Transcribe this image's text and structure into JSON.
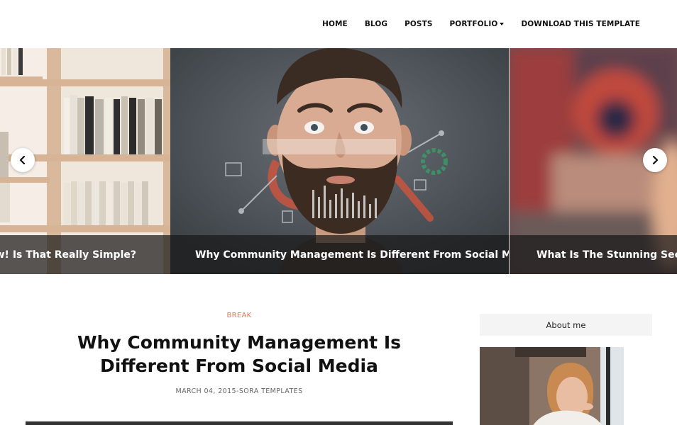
{
  "nav": {
    "items": [
      {
        "label": "HOME"
      },
      {
        "label": "BLOG"
      },
      {
        "label": "POSTS"
      },
      {
        "label": "PORTFOLIO"
      },
      {
        "label": "DOWNLOAD THIS TEMPLATE"
      }
    ]
  },
  "slider": {
    "slides": [
      {
        "caption": "t Now! Is That Really Simple?"
      },
      {
        "caption": "Why Community Management Is Different From Social Media"
      },
      {
        "caption": "What Is The Stunning Secret J"
      }
    ],
    "prev_icon": "chevron-left-icon",
    "next_icon": "chevron-right-icon"
  },
  "post": {
    "label": "BREAK",
    "title_line1": "Why Community Management Is",
    "title_line2": "Different From Social Media",
    "meta": "MARCH 04, 2015-SORA TEMPLATES"
  },
  "sidebar": {
    "about_title": "About me"
  },
  "colors": {
    "accent": "#e0765a",
    "caption_bg": "rgba(25,25,25,0.72)"
  }
}
